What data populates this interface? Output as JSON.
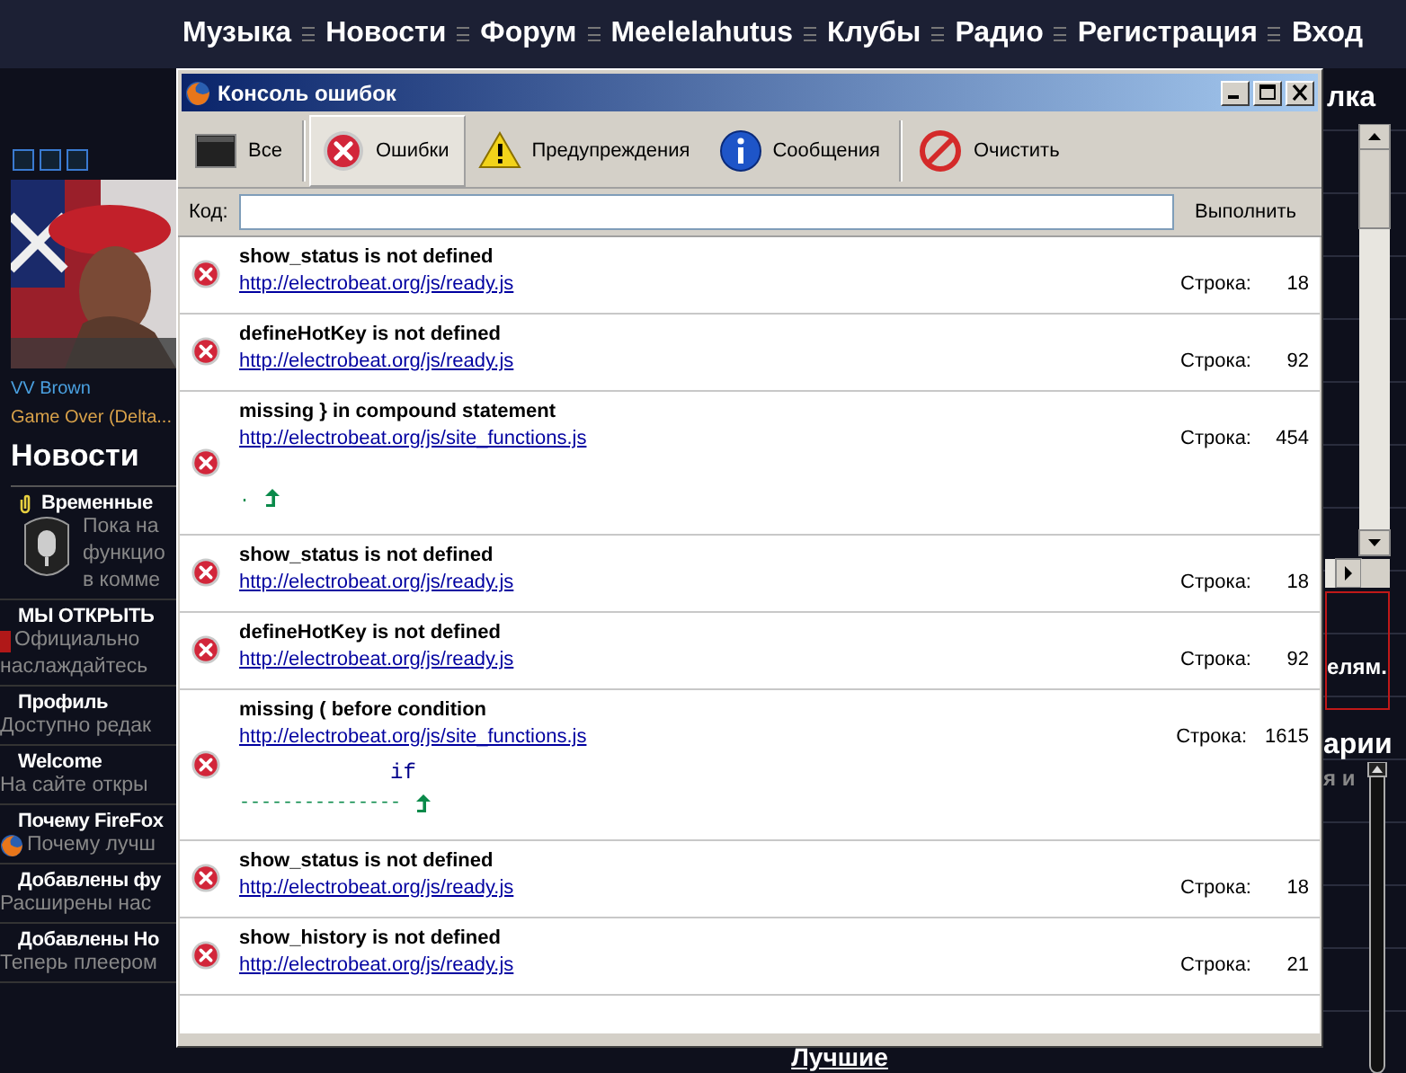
{
  "site": {
    "nav": [
      {
        "label": "Музыка"
      },
      {
        "label": "Новости"
      },
      {
        "label": "Форум"
      },
      {
        "label": "Meelelahutus"
      },
      {
        "label": "Клубы"
      },
      {
        "label": "Радио"
      },
      {
        "label": "Регистрация"
      },
      {
        "label": "Вход"
      }
    ],
    "player": {
      "artist": "VV Brown",
      "track": "Game Over (Delta..."
    },
    "news_heading": "Новости",
    "news": [
      {
        "kind": "pinned",
        "title": "Временные",
        "lines": [
          "Пока на",
          "функцио",
          "в комме"
        ]
      },
      {
        "kind": "note",
        "title": "МЫ ОТКРЫТЬ",
        "lines": [
          "Официально",
          "наслаждайтесь"
        ]
      },
      {
        "kind": "plain",
        "title": "Профиль",
        "lines": [
          "Доступно редак"
        ]
      },
      {
        "kind": "plain",
        "title": "Welcome",
        "lines": [
          "На сайте откры"
        ]
      },
      {
        "kind": "browser",
        "title": "Почему FireFox",
        "lines": [
          "Почему лучш"
        ]
      },
      {
        "kind": "plain",
        "title": "Добавлены фу",
        "lines": [
          "Расширены нас"
        ]
      },
      {
        "kind": "plain",
        "title": "Добавлены Но",
        "lines": [
          "Теперь плеером"
        ]
      }
    ],
    "right": {
      "heading": "лка",
      "box_text": "елям.",
      "heading2": "арии",
      "line": "я и"
    },
    "bottom_heading": "Лучшие"
  },
  "console": {
    "title": "Консоль ошибок",
    "filters": [
      {
        "label": "Все",
        "kind": "all",
        "selected": false
      },
      {
        "label": "Ошибки",
        "kind": "error",
        "selected": true
      },
      {
        "label": "Предупреждения",
        "kind": "warning",
        "selected": false
      },
      {
        "label": "Сообщения",
        "kind": "info",
        "selected": false
      }
    ],
    "clear_button": "Очистить",
    "code_label": "Код:",
    "run_button": "Выполнить",
    "messages": [
      {
        "message": "show_status is not defined",
        "source": "http://electrobeat.org/js/ready.js",
        "line_label": "Строка:",
        "line": "18"
      },
      {
        "message": "defineHotKey is not defined",
        "source": "http://electrobeat.org/js/ready.js",
        "line_label": "Строка:",
        "line": "92"
      },
      {
        "message": "missing } in compound statement",
        "source": "http://electrobeat.org/js/site_functions.js",
        "line_label": "Строка:",
        "line": "454",
        "pointer": "."
      },
      {
        "message": "show_status is not defined",
        "source": "http://electrobeat.org/js/ready.js",
        "line_label": "Строка:",
        "line": "18"
      },
      {
        "message": "defineHotKey is not defined",
        "source": "http://electrobeat.org/js/ready.js",
        "line_label": "Строка:",
        "line": "92"
      },
      {
        "message": "missing ( before condition",
        "source": "http://electrobeat.org/js/site_functions.js",
        "line_label": "Строка:",
        "line": "1615",
        "code": "if",
        "pointer": "---------------"
      },
      {
        "message": "show_status is not defined",
        "source": "http://electrobeat.org/js/ready.js",
        "line_label": "Строка:",
        "line": "18"
      },
      {
        "message": "show_history is not defined",
        "source": "http://electrobeat.org/js/ready.js",
        "line_label": "Строка:",
        "line": "21"
      }
    ]
  }
}
